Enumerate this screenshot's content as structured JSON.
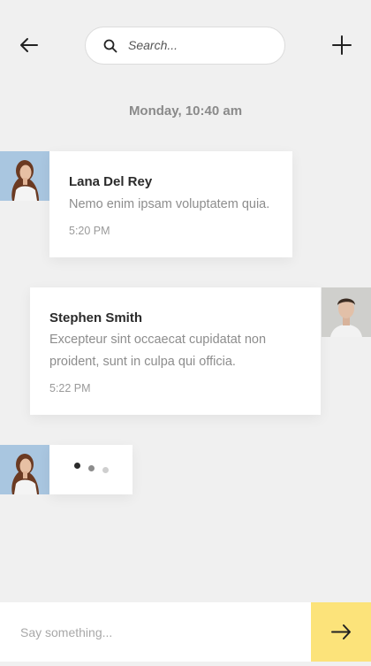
{
  "header": {
    "back_icon": "arrow-left-icon",
    "add_icon": "plus-icon",
    "search": {
      "icon": "search-icon",
      "placeholder": "Search..."
    }
  },
  "thread": {
    "date_separator": "Monday, 10:40 am",
    "messages": [
      {
        "sender": "Lana Del Rey",
        "text": "Nemo enim ipsam voluptatem quia.",
        "time": "5:20 PM",
        "side": "left"
      },
      {
        "sender": "Stephen Smith",
        "text_lines": [
          "Excepteur sint occaecat cupidatat non",
          "proident, sunt in culpa qui officia."
        ],
        "time": "5:22 PM",
        "side": "right"
      }
    ],
    "typing": {
      "side": "left",
      "dots": 3
    }
  },
  "composer": {
    "placeholder": "Say something...",
    "send_icon": "arrow-right-icon",
    "send_color": "#fce37a"
  }
}
